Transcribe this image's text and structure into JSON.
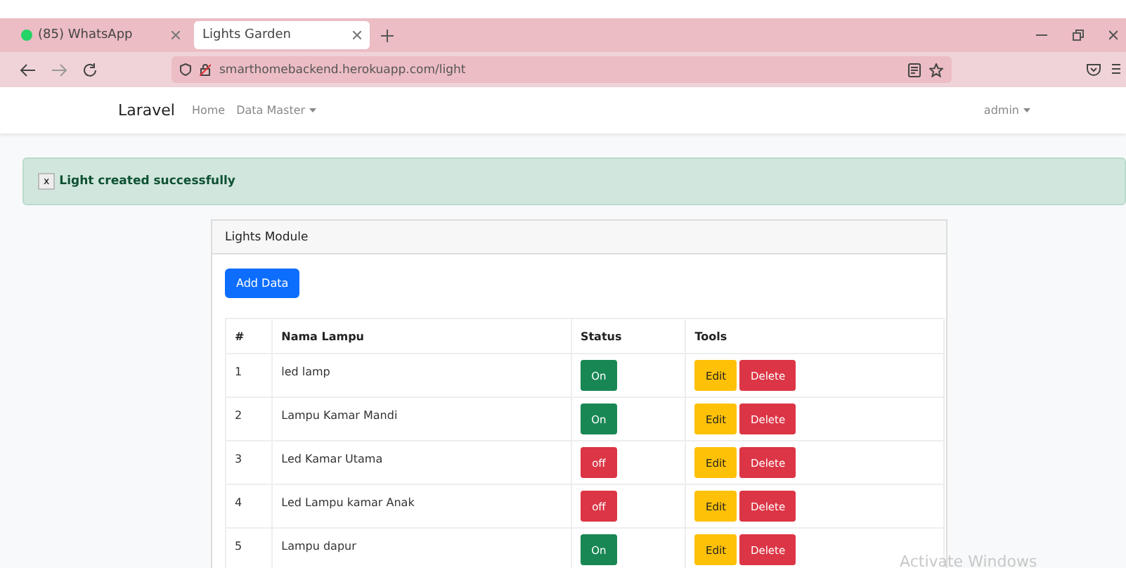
{
  "browser": {
    "tabs": [
      {
        "title": "(85) WhatsApp",
        "selected": false
      },
      {
        "title": "Lights Garden",
        "selected": true
      }
    ],
    "url": "smarthomebackend.herokuapp.com/light"
  },
  "navbar": {
    "brand": "Laravel",
    "links": [
      {
        "label": "Home",
        "dropdown": false
      },
      {
        "label": "Data Master",
        "dropdown": true
      }
    ],
    "user": {
      "label": "admin",
      "dropdown": true
    }
  },
  "alert": {
    "close": "x",
    "message": "Light created successfully"
  },
  "card": {
    "title": "Lights Module",
    "add_button": "Add Data",
    "table": {
      "columns": [
        "#",
        "Nama Lampu",
        "Status",
        "Tools"
      ],
      "rows": [
        {
          "no": "1",
          "name": "led lamp",
          "status": "On",
          "on": true,
          "edit": "Edit",
          "delete": "Delete"
        },
        {
          "no": "2",
          "name": "Lampu Kamar Mandi",
          "status": "On",
          "on": true,
          "edit": "Edit",
          "delete": "Delete"
        },
        {
          "no": "3",
          "name": "Led Kamar Utama",
          "status": "off",
          "on": false,
          "edit": "Edit",
          "delete": "Delete"
        },
        {
          "no": "4",
          "name": "Led Lampu kamar Anak",
          "status": "off",
          "on": false,
          "edit": "Edit",
          "delete": "Delete"
        },
        {
          "no": "5",
          "name": "Lampu dapur",
          "status": "On",
          "on": true,
          "edit": "Edit",
          "delete": "Delete"
        }
      ]
    }
  },
  "os_notice": "Activate Windows"
}
